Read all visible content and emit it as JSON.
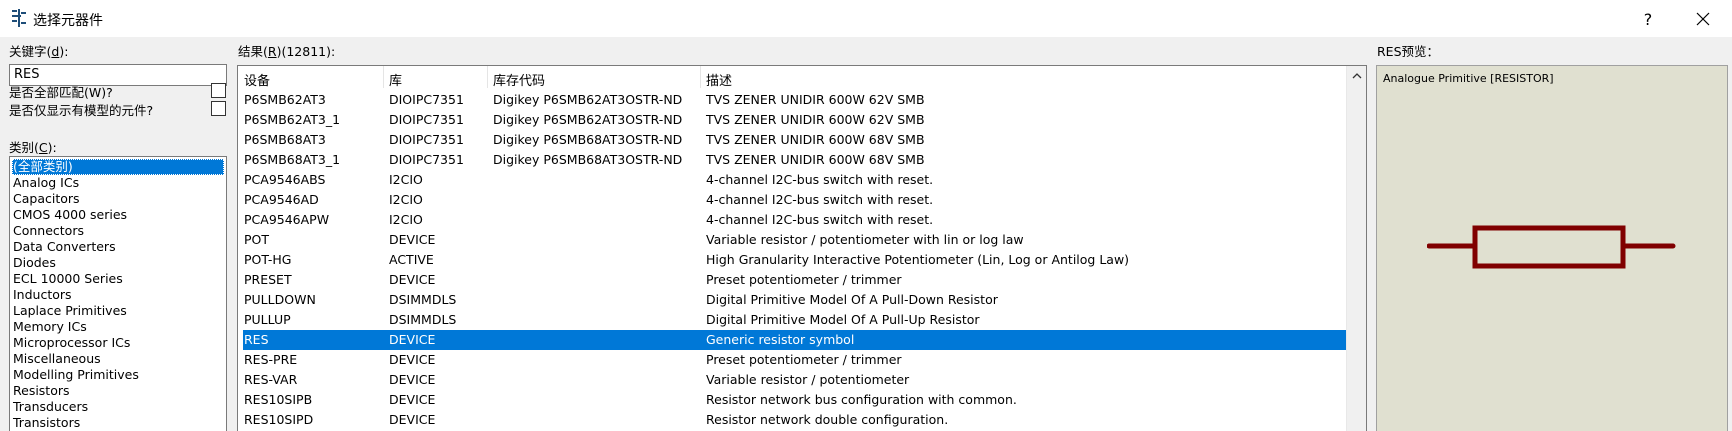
{
  "window": {
    "title": "选择元器件",
    "help_label": "?"
  },
  "keyword": {
    "label_prefix": "关键字(",
    "label_key": "d",
    "label_suffix": "):",
    "value": "RES"
  },
  "options": {
    "match_all": "是否全部匹配(W)?",
    "models_only": "是否仅显示有模型的元件?"
  },
  "category": {
    "label_prefix": "类别(",
    "label_key": "C",
    "label_suffix": "):",
    "items": [
      "(全部类别)",
      "Analog ICs",
      "Capacitors",
      "CMOS 4000 series",
      "Connectors",
      "Data Converters",
      "Diodes",
      "ECL 10000 Series",
      "Inductors",
      "Laplace Primitives",
      "Memory ICs",
      "Microprocessor ICs",
      "Miscellaneous",
      "Modelling Primitives",
      "Resistors",
      "Transducers",
      "Transistors"
    ]
  },
  "results": {
    "label_prefix": "结果(",
    "label_key": "R",
    "label_suffix": ")(12811):",
    "columns": [
      "设备",
      "库",
      "库存代码",
      "描述"
    ],
    "selected_index": 12,
    "rows": [
      [
        "P6SMB62AT3",
        "DIOIPC7351",
        "Digikey P6SMB62AT3OSTR-ND",
        "TVS ZENER UNIDIR 600W 62V SMB"
      ],
      [
        "P6SMB62AT3_1",
        "DIOIPC7351",
        "Digikey P6SMB62AT3OSTR-ND",
        "TVS ZENER UNIDIR 600W 62V SMB"
      ],
      [
        "P6SMB68AT3",
        "DIOIPC7351",
        "Digikey P6SMB68AT3OSTR-ND",
        "TVS ZENER UNIDIR 600W 68V SMB"
      ],
      [
        "P6SMB68AT3_1",
        "DIOIPC7351",
        "Digikey P6SMB68AT3OSTR-ND",
        "TVS ZENER UNIDIR 600W 68V SMB"
      ],
      [
        "PCA9546ABS",
        "I2CIO",
        "",
        "4-channel I2C-bus switch with reset."
      ],
      [
        "PCA9546AD",
        "I2CIO",
        "",
        "4-channel I2C-bus switch with reset."
      ],
      [
        "PCA9546APW",
        "I2CIO",
        "",
        "4-channel I2C-bus switch with reset."
      ],
      [
        "POT",
        "DEVICE",
        "",
        "Variable resistor / potentiometer with lin or log law"
      ],
      [
        "POT-HG",
        "ACTIVE",
        "",
        "High Granularity Interactive Potentiometer (Lin, Log or Antilog Law)"
      ],
      [
        "PRESET",
        "DEVICE",
        "",
        "Preset potentiometer / trimmer"
      ],
      [
        "PULLDOWN",
        "DSIMMDLS",
        "",
        "Digital Primitive Model Of A Pull-Down Resistor"
      ],
      [
        "PULLUP",
        "DSIMMDLS",
        "",
        "Digital Primitive Model Of A Pull-Up Resistor"
      ],
      [
        "RES",
        "DEVICE",
        "",
        "Generic resistor symbol"
      ],
      [
        "RES-PRE",
        "DEVICE",
        "",
        "Preset potentiometer / trimmer"
      ],
      [
        "RES-VAR",
        "DEVICE",
        "",
        "Variable resistor / potentiometer"
      ],
      [
        "RES10SIPB",
        "DEVICE",
        "",
        "Resistor network bus configuration with common."
      ],
      [
        "RES10SIPD",
        "DEVICE",
        "",
        "Resistor network double configuration."
      ]
    ]
  },
  "preview": {
    "label": "RES预览：",
    "caption": "Analogue Primitive [RESISTOR]",
    "symbol_color": "#800000",
    "background": "#e0e0d0"
  },
  "colors": {
    "selection": "#0078d7"
  }
}
